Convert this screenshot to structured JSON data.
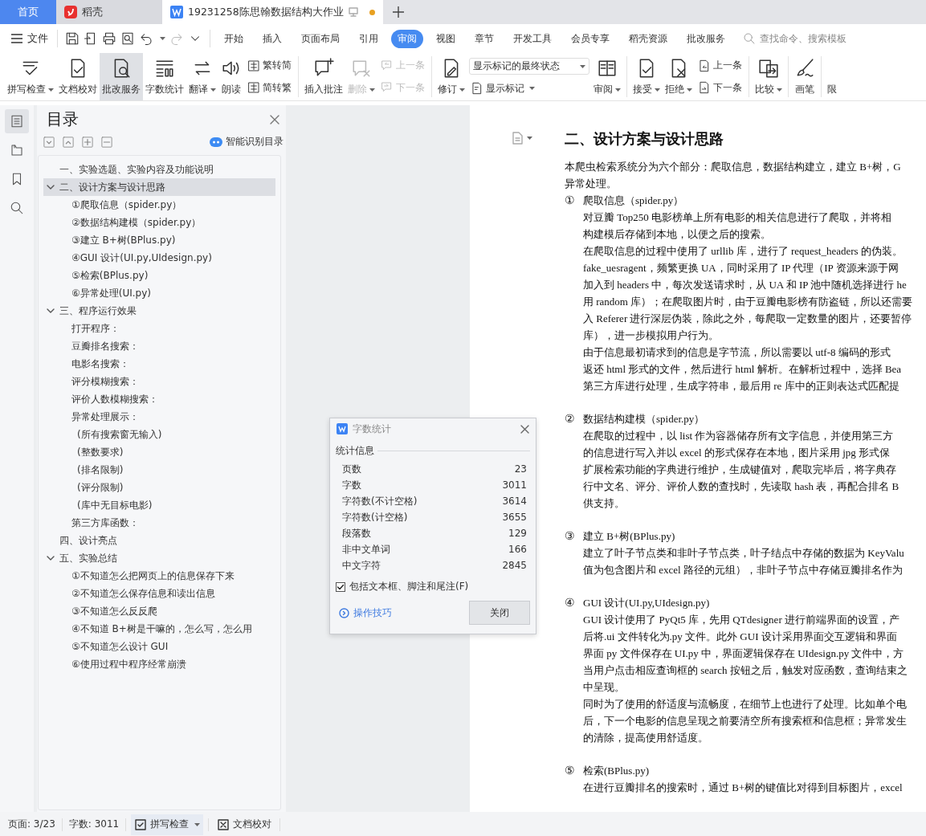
{
  "tabs": [
    {
      "label": "首页",
      "kind": "home",
      "selected": false
    },
    {
      "label": "稻壳",
      "kind": "app",
      "selected": false
    },
    {
      "label": "19231258陈思翰数据结构大作业",
      "kind": "doc",
      "selected": true,
      "modified": true
    }
  ],
  "menu": {
    "file": "文件",
    "quick_access": [
      {
        "disabled": false
      },
      {
        "disabled": false
      },
      {
        "disabled": false
      },
      {
        "disabled": false
      },
      {
        "disabled": false
      },
      {
        "disabled": true
      },
      {
        "disabled": false
      }
    ],
    "tabs": [
      {
        "label": "开始",
        "selected": false
      },
      {
        "label": "插入",
        "selected": false
      },
      {
        "label": "页面布局",
        "selected": false
      },
      {
        "label": "引用",
        "selected": false
      },
      {
        "label": "审阅",
        "selected": true
      },
      {
        "label": "视图",
        "selected": false
      },
      {
        "label": "章节",
        "selected": false
      },
      {
        "label": "开发工具",
        "selected": false
      },
      {
        "label": "会员专享",
        "selected": false
      },
      {
        "label": "稻壳资源",
        "selected": false
      },
      {
        "label": "批改服务",
        "selected": false
      }
    ],
    "search_placeholder": "查找命令、搜索模板"
  },
  "ribbon": [
    {
      "items": [
        {
          "kind": "big",
          "label": "拼写检查",
          "caret": true,
          "selected": false,
          "disabled": false
        },
        {
          "kind": "big",
          "label": "文档校对",
          "caret": false,
          "selected": false,
          "disabled": false
        },
        {
          "kind": "big",
          "label": "批改服务",
          "caret": false,
          "selected": true,
          "disabled": false
        },
        {
          "kind": "big",
          "label": "字数统计",
          "caret": false,
          "selected": false,
          "disabled": false
        },
        {
          "kind": "big",
          "label": "翻译",
          "caret": true,
          "selected": false,
          "disabled": false
        },
        {
          "kind": "big",
          "label": "朗读",
          "caret": false,
          "selected": false,
          "disabled": false
        },
        {
          "kind": "pair",
          "buttons": [
            {
              "label": "繁转简",
              "disabled": false
            },
            {
              "label": "简转繁",
              "disabled": false
            }
          ]
        }
      ]
    },
    {
      "items": [
        {
          "kind": "big",
          "label": "插入批注",
          "caret": false,
          "selected": false,
          "disabled": false
        },
        {
          "kind": "big",
          "label": "删除",
          "caret": true,
          "selected": false,
          "disabled": true
        },
        {
          "kind": "pair",
          "buttons": [
            {
              "label": "上一条",
              "disabled": true
            },
            {
              "label": "下一条",
              "disabled": true
            }
          ]
        }
      ]
    },
    {
      "items": [
        {
          "kind": "big",
          "label": "修订",
          "caret": true,
          "selected": false,
          "disabled": false
        },
        {
          "kind": "select",
          "value": "显示标记的最终状态",
          "button": {
            "label": "显示标记",
            "disabled": false
          }
        },
        {
          "kind": "big",
          "label": "审阅",
          "caret": true,
          "selected": false,
          "disabled": false
        }
      ]
    },
    {
      "items": [
        {
          "kind": "big",
          "label": "接受",
          "caret": true,
          "selected": false,
          "disabled": false
        },
        {
          "kind": "big",
          "label": "拒绝",
          "caret": true,
          "selected": false,
          "disabled": false
        },
        {
          "kind": "pair",
          "buttons": [
            {
              "label": "上一条",
              "disabled": false
            },
            {
              "label": "下一条",
              "disabled": false
            }
          ]
        }
      ]
    },
    {
      "items": [
        {
          "kind": "big",
          "label": "比较",
          "caret": true,
          "selected": false,
          "disabled": false
        }
      ]
    },
    {
      "items": [
        {
          "kind": "big",
          "label": "画笔",
          "caret": false,
          "selected": false,
          "disabled": false
        }
      ]
    },
    {
      "items": [
        {
          "kind": "big",
          "label": "限",
          "caret": false,
          "selected": false,
          "disabled": false
        }
      ]
    }
  ],
  "rail": [
    {
      "selected": true
    },
    {
      "selected": false
    },
    {
      "selected": false
    },
    {
      "selected": false
    }
  ],
  "toc": {
    "title": "目录",
    "smart_button": "智能识别目录",
    "items": [
      {
        "text": "一、实验选题、实验内容及功能说明",
        "selected": false
      },
      {
        "text": "二、设计方案与设计思路",
        "selected": true,
        "expanded": true,
        "children": [
          {
            "text": "①爬取信息（spider.py）",
            "selected": false
          },
          {
            "text": "②数据结构建模（spider.py）",
            "selected": false
          },
          {
            "text": "③建立 B+树(BPlus.py)",
            "selected": false
          },
          {
            "text": "④GUI 设计(UI.py,UIdesign.py)",
            "selected": false
          },
          {
            "text": "⑤检索(BPlus.py)",
            "selected": false
          },
          {
            "text": "⑥异常处理(UI.py)",
            "selected": false
          }
        ]
      },
      {
        "text": "三、程序运行效果",
        "selected": false,
        "expanded": true,
        "children": [
          {
            "text": "打开程序：",
            "selected": false
          },
          {
            "text": "豆瓣排名搜索：",
            "selected": false
          },
          {
            "text": "电影名搜索：",
            "selected": false
          },
          {
            "text": "评分模糊搜索：",
            "selected": false
          },
          {
            "text": "评价人数模糊搜索：",
            "selected": false
          },
          {
            "text": "异常处理展示：",
            "selected": false,
            "children": [
              {
                "text": "(所有搜索窗无输入)",
                "selected": false
              },
              {
                "text": "(整数要求)",
                "selected": false
              },
              {
                "text": "(排名限制)",
                "selected": false
              },
              {
                "text": "(评分限制)",
                "selected": false
              },
              {
                "text": "(库中无目标电影)",
                "selected": false
              }
            ]
          },
          {
            "text": "第三方库函数：",
            "selected": false
          }
        ]
      },
      {
        "text": "四、设计亮点",
        "selected": false
      },
      {
        "text": "五、实验总结",
        "selected": false,
        "expanded": true,
        "children": [
          {
            "text": "①不知道怎么把网页上的信息保存下来",
            "selected": false
          },
          {
            "text": "②不知道怎么保存信息和读出信息",
            "selected": false
          },
          {
            "text": "③不知道怎么反反爬",
            "selected": false
          },
          {
            "text": "④不知道 B+树是干嘛的，怎么写，怎么用",
            "selected": false
          },
          {
            "text": "⑤不知道怎么设计 GUI",
            "selected": false
          },
          {
            "text": "⑥使用过程中程序经常崩溃",
            "selected": false
          }
        ]
      }
    ]
  },
  "document": {
    "heading": "二、设计方案与设计思路",
    "intro": [
      "本爬虫检索系统分为六个部分：爬取信息，数据结构建立，建立 B+树，G",
      "异常处理。"
    ],
    "sections": [
      {
        "marker": "①",
        "title": "爬取信息（spider.py）",
        "lines": [
          "对豆瓣 Top250 电影榜单上所有电影的相关信息进行了爬取，并将相",
          "构建模后存储到本地，以便之后的搜索。",
          "在爬取信息的过程中使用了 urllib 库，进行了 request_headers 的伪装。",
          "fake_uesragent，频繁更换 UA，同时采用了 IP 代理（IP 资源来源于网",
          "加入到 headers 中，每次发送请求时，从 UA 和 IP 池中随机选择进行 he",
          "用 random 库）；在爬取图片时，由于豆瓣电影榜有防盗链，所以还需要",
          "入 Referer 进行深层伪装，除此之外，每爬取一定数量的图片，还要暂停",
          "库），进一步模拟用户行为。",
          "由于信息最初请求到的信息是字节流，所以需要以 utf-8 编码的形式",
          "返还 html 形式的文件，然后进行 html 解析。在解析过程中，选择 Bea",
          "第三方库进行处理，生成字符串，最后用 re 库中的正则表达式匹配提"
        ]
      },
      {
        "marker": "②",
        "title": "数据结构建模（spider.py）",
        "lines": [
          "在爬取的过程中，以 list 作为容器储存所有文字信息，并使用第三方",
          "的信息进行写入并以 excel 的形式保存在本地，图片采用 jpg 形式保",
          "扩展检索功能的字典进行维护，生成键值对，爬取完毕后，将字典存",
          "行中文名、评分、评价人数的查找时，先读取 hash 表，再配合排名 B",
          "供支持。"
        ]
      },
      {
        "marker": "③",
        "title": "建立 B+树(BPlus.py)",
        "lines": [
          "建立了叶子节点类和非叶子节点类，叶子结点中存储的数据为 KeyValu",
          "值为包含图片和 excel 路径的元组），非叶子节点中存储豆瓣排名作为"
        ]
      },
      {
        "marker": "④",
        "title": "GUI 设计(UI.py,UIdesign.py)",
        "lines": [
          "GUI 设计使用了 PyQt5 库，先用 QTdesigner 进行前端界面的设置，产",
          "后将.ui 文件转化为.py 文件。此外 GUI 设计采用界面交互逻辑和界面",
          "界面 py 文件保存在 UI.py 中，界面逻辑保存在 UIdesign.py 文件中，方",
          "当用户点击相应查询框的 search 按钮之后，触发对应函数，查询结束之",
          "中呈现。",
          "同时为了使用的舒适度与流畅度，在细节上也进行了处理。比如单个电",
          "后，下一个电影的信息呈现之前要清空所有搜索框和信息框；异常发生",
          "的清除，提高使用舒适度。"
        ]
      },
      {
        "marker": "⑤",
        "title": "检索(BPlus.py)",
        "lines": [
          "在进行豆瓣排名的搜索时，通过 B+树的键值比对得到目标图片，excel"
        ]
      }
    ]
  },
  "dialog": {
    "title": "字数统计",
    "section": "统计信息",
    "rows": [
      {
        "label": "页数",
        "value": "23"
      },
      {
        "label": "字数",
        "value": "3011"
      },
      {
        "label": "字符数(不计空格)",
        "value": "3614"
      },
      {
        "label": "字符数(计空格)",
        "value": "3655"
      },
      {
        "label": "段落数",
        "value": "129"
      },
      {
        "label": "非中文单词",
        "value": "166"
      },
      {
        "label": "中文字符",
        "value": "2845"
      }
    ],
    "checkbox": {
      "label": "包括文本框、脚注和尾注(F)",
      "checked": true
    },
    "link": "操作技巧",
    "button": "关闭"
  },
  "status_bar": {
    "page": "页面: 3/23",
    "words": "字数: 3011",
    "spell": "拼写检查",
    "proof": "文档校对"
  }
}
